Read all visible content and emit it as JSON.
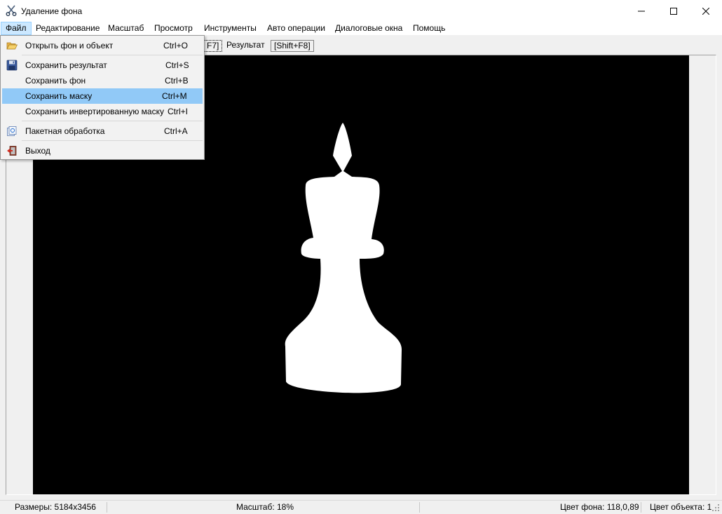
{
  "window": {
    "title": "Удаление фона",
    "icon": "scissors-icon"
  },
  "menubar": {
    "items": [
      {
        "label": "Файл"
      },
      {
        "label": "Редактирование"
      },
      {
        "label": "Масштаб"
      },
      {
        "label": "Просмотр"
      },
      {
        "label": "Инструменты"
      },
      {
        "label": "Авто операции"
      },
      {
        "label": "Диалоговые окна"
      },
      {
        "label": "Помощь"
      }
    ]
  },
  "tabs": {
    "partial": "F7]",
    "result": "Результат",
    "result_shortcut": "[Shift+F8]"
  },
  "file_menu": {
    "items": [
      {
        "label": "Открыть фон и объект",
        "shortcut": "Ctrl+O",
        "icon": "folder-open-icon"
      },
      {
        "label": "Сохранить результат",
        "shortcut": "Ctrl+S",
        "icon": "floppy-disk-icon"
      },
      {
        "label": "Сохранить фон",
        "shortcut": "Ctrl+B"
      },
      {
        "label": "Сохранить маску",
        "shortcut": "Ctrl+M",
        "highlighted": true
      },
      {
        "label": "Сохранить инвертированную маску",
        "shortcut": "Ctrl+I"
      },
      {
        "label": "Пакетная обработка",
        "shortcut": "Ctrl+A",
        "icon": "batch-icon"
      },
      {
        "label": "Выход",
        "icon": "exit-icon"
      }
    ]
  },
  "statusbar": {
    "size": "Размеры: 5184x3456",
    "zoom": "Масштаб: 18%",
    "bg_color": "Цвет фона: 118,0,89",
    "obj_color": "Цвет объекта: 1"
  },
  "colors": {
    "menu_highlight": "#91c9f7",
    "active_menu": "#cce8ff",
    "canvas_bg": "#000000",
    "mask_fg": "#ffffff"
  }
}
